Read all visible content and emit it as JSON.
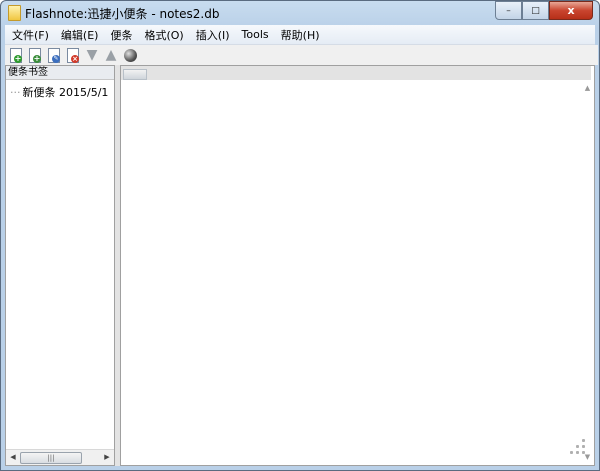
{
  "window": {
    "title": "Flashnote:迅捷小便条 - notes2.db",
    "caption": {
      "minimize": "–",
      "maximize": "□",
      "close": "x"
    }
  },
  "menubar": {
    "items": [
      "文件(F)",
      "编辑(E)",
      "便条",
      "格式(O)",
      "插入(I)",
      "Tools",
      "帮助(H)"
    ]
  },
  "toolbar": {
    "buttons": [
      {
        "icon": "new-note-icon"
      },
      {
        "icon": "new-child-note-icon"
      },
      {
        "icon": "edit-note-icon"
      },
      {
        "icon": "delete-note-icon"
      },
      {
        "icon": "move-down-icon"
      },
      {
        "icon": "move-up-icon"
      },
      {
        "icon": "globe-icon"
      }
    ]
  },
  "left_pane": {
    "header": "便条书签",
    "tree": [
      {
        "label": "新便条 2015/5/1"
      }
    ]
  },
  "scroll": {
    "thumb": "|||"
  },
  "colors": {
    "accent": "#b9d0e8",
    "close": "#c9452f"
  }
}
